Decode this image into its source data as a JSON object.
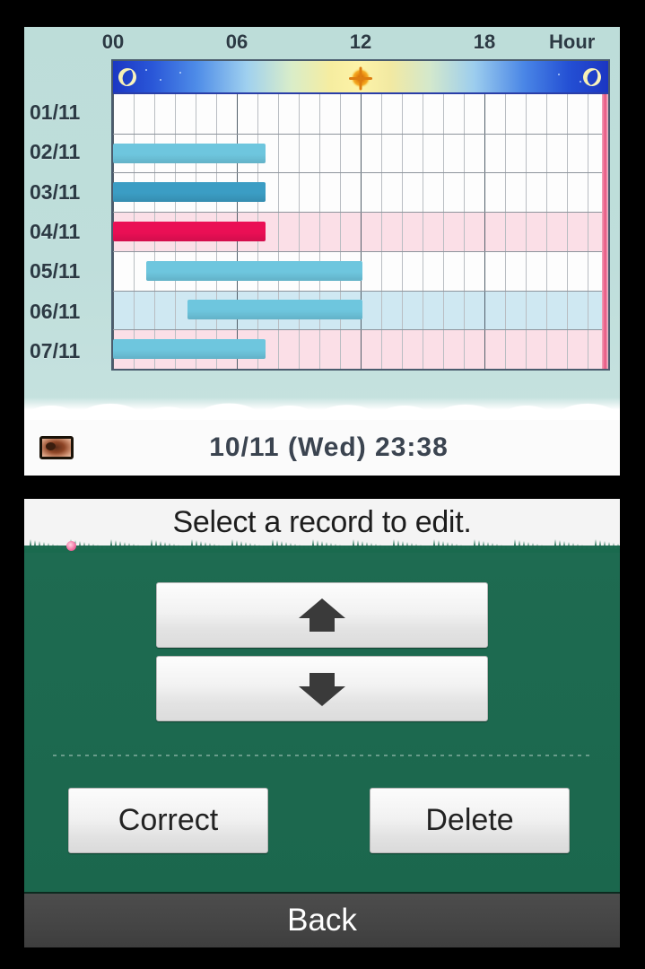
{
  "top_screen": {
    "hour_axis_label": "Hour",
    "hour_ticks": [
      "00",
      "06",
      "12",
      "18"
    ],
    "footer": {
      "datetime": "10/11 (Wed) 23:38",
      "sleep_icon": "bed-icon"
    }
  },
  "bottom_screen": {
    "prompt": "Select a record to edit.",
    "scroll_up_label": "▲",
    "scroll_down_label": "▼",
    "correct_label": "Correct",
    "delete_label": "Delete",
    "back_label": "Back"
  },
  "colors": {
    "sleep_bar_light": "#6ec6de",
    "sleep_bar_dark": "#3b9dc4",
    "selected_bar": "#ea0f55",
    "screen_bg": "#bcdcd9",
    "panel_green": "#1e6b51",
    "back_bar": "#464646",
    "night_blue": "#1b37c4",
    "day_yellow": "#fdf3a8"
  },
  "chart_data": {
    "type": "bar",
    "title": "Sleep record timeline",
    "xlabel": "Hour",
    "ylabel": "",
    "xlim": [
      0,
      24
    ],
    "xticks": [
      0,
      6,
      12,
      18
    ],
    "xtick_labels": [
      "00",
      "06",
      "12",
      "18"
    ],
    "grid": true,
    "legend": "none",
    "orientation": "horizontal",
    "categories": [
      "01/11",
      "02/11",
      "03/11",
      "04/11",
      "05/11",
      "06/11",
      "07/11"
    ],
    "bars": [
      {
        "day": "01/11",
        "start_hour": null,
        "end_hour": null,
        "color": null,
        "selected": false,
        "row_tint": "none"
      },
      {
        "day": "02/11",
        "start_hour": 0.0,
        "end_hour": 7.4,
        "color": "#6ec6de",
        "selected": false,
        "row_tint": "none"
      },
      {
        "day": "03/11",
        "start_hour": 0.0,
        "end_hour": 7.4,
        "color": "#3b9dc4",
        "selected": false,
        "row_tint": "none"
      },
      {
        "day": "04/11",
        "start_hour": 0.0,
        "end_hour": 7.4,
        "color": "#ea0f55",
        "selected": true,
        "row_tint": "pink"
      },
      {
        "day": "05/11",
        "start_hour": 1.6,
        "end_hour": 12.1,
        "color": "#6ec6de",
        "selected": false,
        "row_tint": "none"
      },
      {
        "day": "06/11",
        "start_hour": 3.6,
        "end_hour": 12.1,
        "color": "#6ec6de",
        "selected": false,
        "row_tint": "blue"
      },
      {
        "day": "07/11",
        "start_hour": 0.0,
        "end_hour": 7.4,
        "color": "#6ec6de",
        "selected": false,
        "row_tint": "pink"
      }
    ],
    "day_night_band": {
      "sunrise_hour": 6,
      "noon_hour": 12,
      "sunset_hour": 18,
      "sun_icon": "sun-icon",
      "moon_icon": "moon-icon"
    },
    "right_marker": {
      "hour": 23.6,
      "color": "#e8537f"
    }
  }
}
